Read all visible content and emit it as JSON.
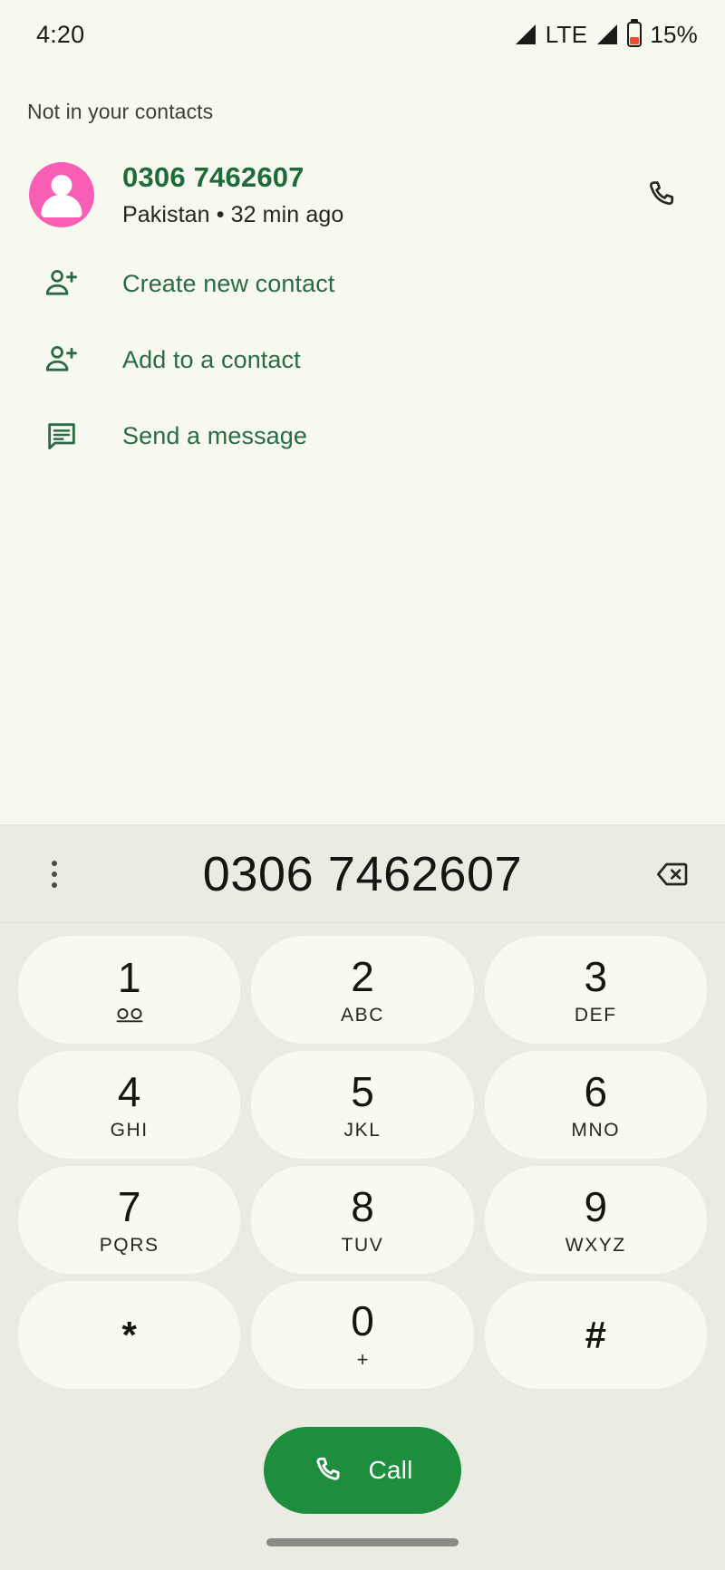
{
  "status_bar": {
    "time": "4:20",
    "network_type": "LTE",
    "battery_percent": "15%",
    "battery_level": 15,
    "icons": [
      "signal-bars-icon",
      "lte-label",
      "signal-bars-icon",
      "battery-low-icon"
    ]
  },
  "results": {
    "section_label": "Not in your contacts",
    "contact": {
      "number": "0306 7462607",
      "subtitle": "Pakistan • 32 min ago",
      "avatar_color": "#F75EB4",
      "number_color": "#1E6B39",
      "call_icon": "phone-icon"
    },
    "actions": [
      {
        "label": "Create new contact",
        "icon": "person-add-icon"
      },
      {
        "label": "Add to a contact",
        "icon": "person-add-icon"
      },
      {
        "label": "Send a message",
        "icon": "message-icon"
      }
    ]
  },
  "dialpad": {
    "overflow_icon": "overflow-menu-icon",
    "entered_number": "0306 7462607",
    "backspace_icon": "backspace-icon",
    "keys": [
      {
        "digit": "1",
        "letters": "",
        "icon": "voicemail-icon"
      },
      {
        "digit": "2",
        "letters": "ABC",
        "icon": ""
      },
      {
        "digit": "3",
        "letters": "DEF",
        "icon": ""
      },
      {
        "digit": "4",
        "letters": "GHI",
        "icon": ""
      },
      {
        "digit": "5",
        "letters": "JKL",
        "icon": ""
      },
      {
        "digit": "6",
        "letters": "MNO",
        "icon": ""
      },
      {
        "digit": "7",
        "letters": "PQRS",
        "icon": ""
      },
      {
        "digit": "8",
        "letters": "TUV",
        "icon": ""
      },
      {
        "digit": "9",
        "letters": "WXYZ",
        "icon": ""
      },
      {
        "digit": "*",
        "letters": "",
        "icon": ""
      },
      {
        "digit": "0",
        "letters": "+",
        "icon": ""
      },
      {
        "digit": "#",
        "letters": "",
        "icon": ""
      }
    ],
    "call_button": {
      "label": "Call",
      "icon": "phone-icon",
      "color": "#1E8E3E"
    }
  },
  "navigation": {
    "gesture_pill": "home-gesture-pill"
  }
}
